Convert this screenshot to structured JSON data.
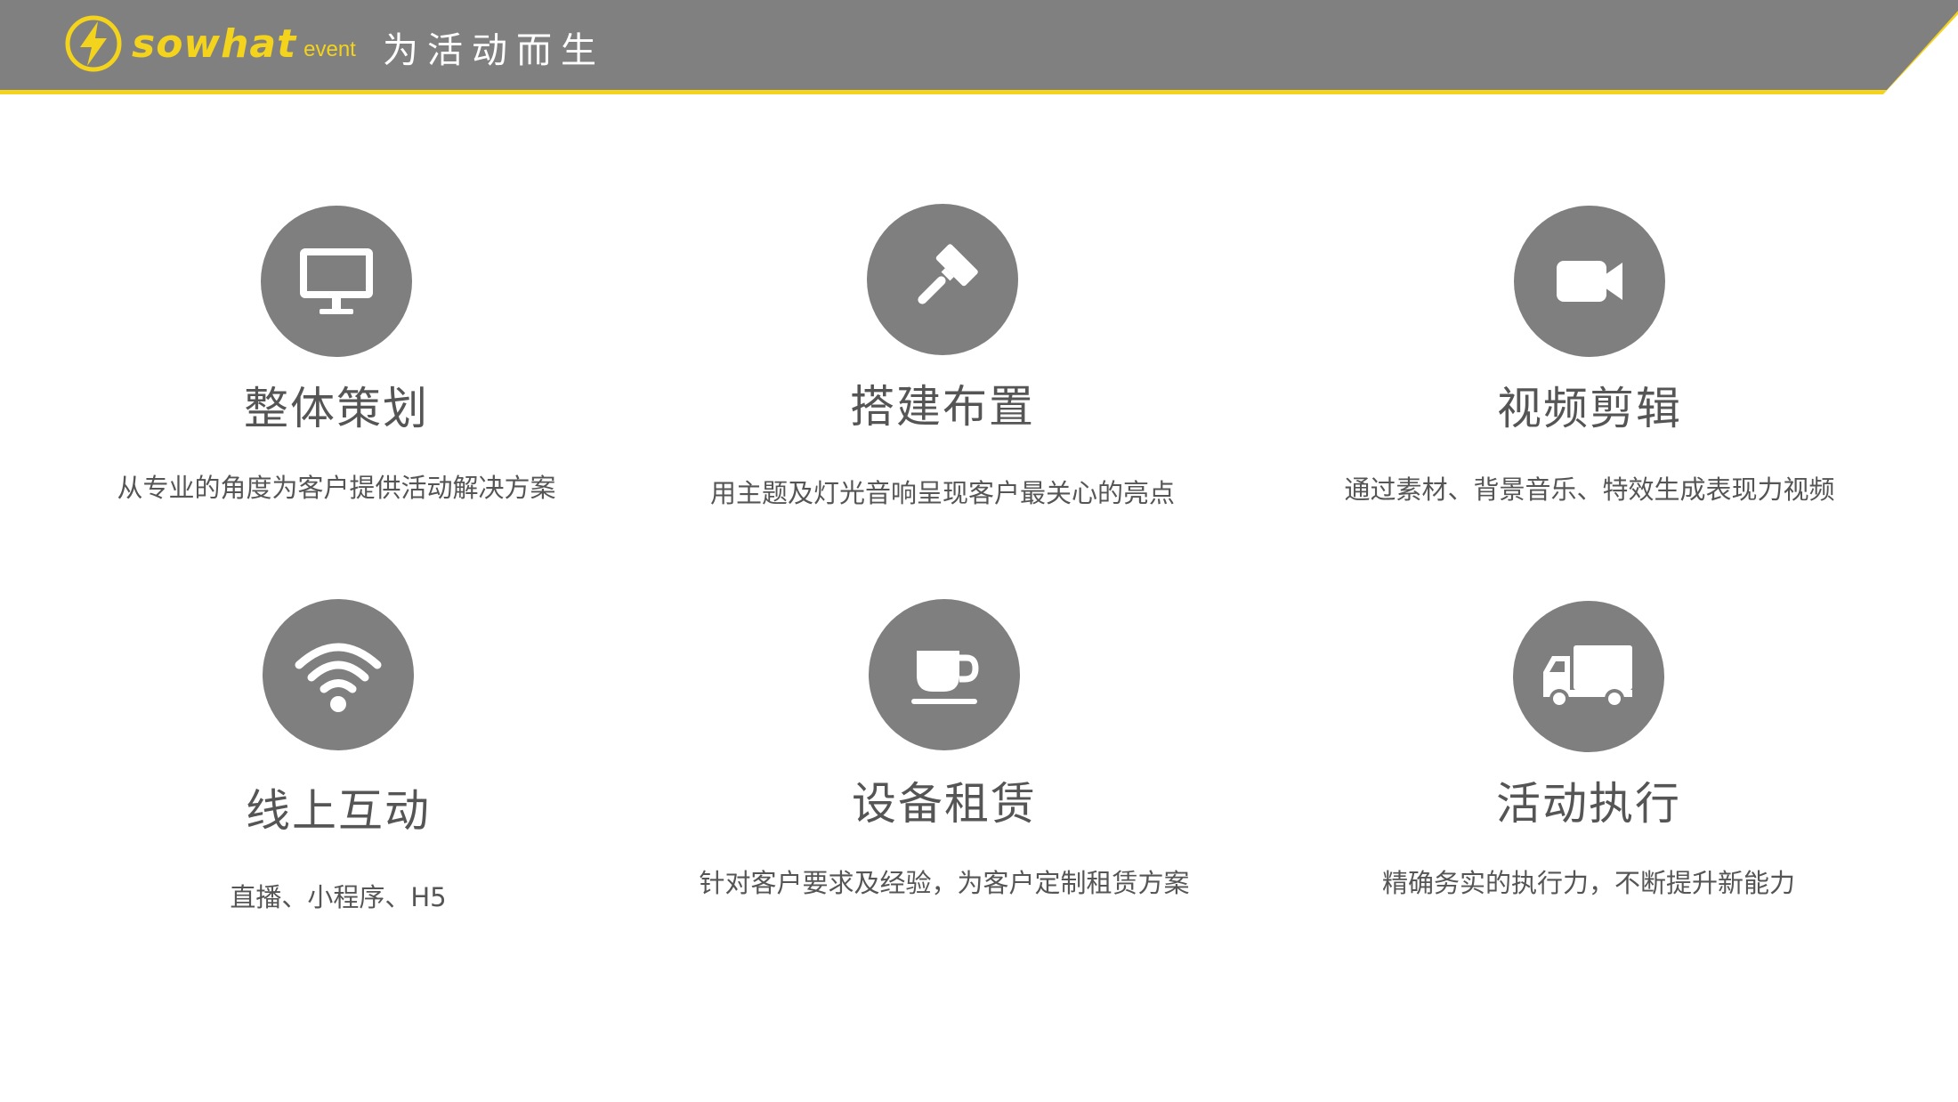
{
  "brand": {
    "logo_word": "sowhat",
    "logo_suffix": "event",
    "slogan": "为活动而生"
  },
  "colors": {
    "header_bar": "#808080",
    "accent_yellow": "#f3d31c",
    "icon_circle": "#7f7f7f",
    "text": "#555555"
  },
  "services": [
    {
      "title": "整体策划",
      "desc": "从专业的角度为客户提供活动解决方案",
      "icon": "monitor-icon"
    },
    {
      "title": "搭建布置",
      "desc": "用主题及灯光音响呈现客户最关心的亮点",
      "icon": "gavel-icon"
    },
    {
      "title": "视频剪辑",
      "desc": "通过素材、背景音乐、特效生成表现力视频",
      "icon": "video-camera-icon"
    },
    {
      "title": "线上互动",
      "desc": "直播、小程序、H5",
      "icon": "wifi-icon"
    },
    {
      "title": "设备租赁",
      "desc": "针对客户要求及经验，为客户定制租赁方案",
      "icon": "coffee-cup-icon"
    },
    {
      "title": "活动执行",
      "desc": "精确务实的执行力，不断提升新能力",
      "icon": "truck-icon"
    }
  ]
}
